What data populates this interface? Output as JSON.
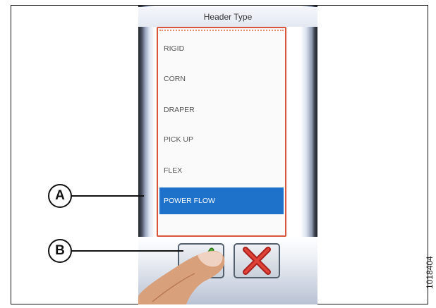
{
  "screen": {
    "title": "Header Type",
    "items": [
      {
        "label": "RIGID",
        "selected": false
      },
      {
        "label": "CORN",
        "selected": false
      },
      {
        "label": "DRAPER",
        "selected": false
      },
      {
        "label": "PICK UP",
        "selected": false
      },
      {
        "label": "FLEX",
        "selected": false
      },
      {
        "label": "POWER FLOW",
        "selected": true
      }
    ],
    "accent_color": "#1f72c9",
    "list_border_color": "#d9553c",
    "buttons": {
      "confirm_icon": "green-checkmark-icon",
      "cancel_icon": "red-x-icon"
    }
  },
  "callouts": {
    "a": "A",
    "b": "B"
  },
  "figure_id": "1018404"
}
